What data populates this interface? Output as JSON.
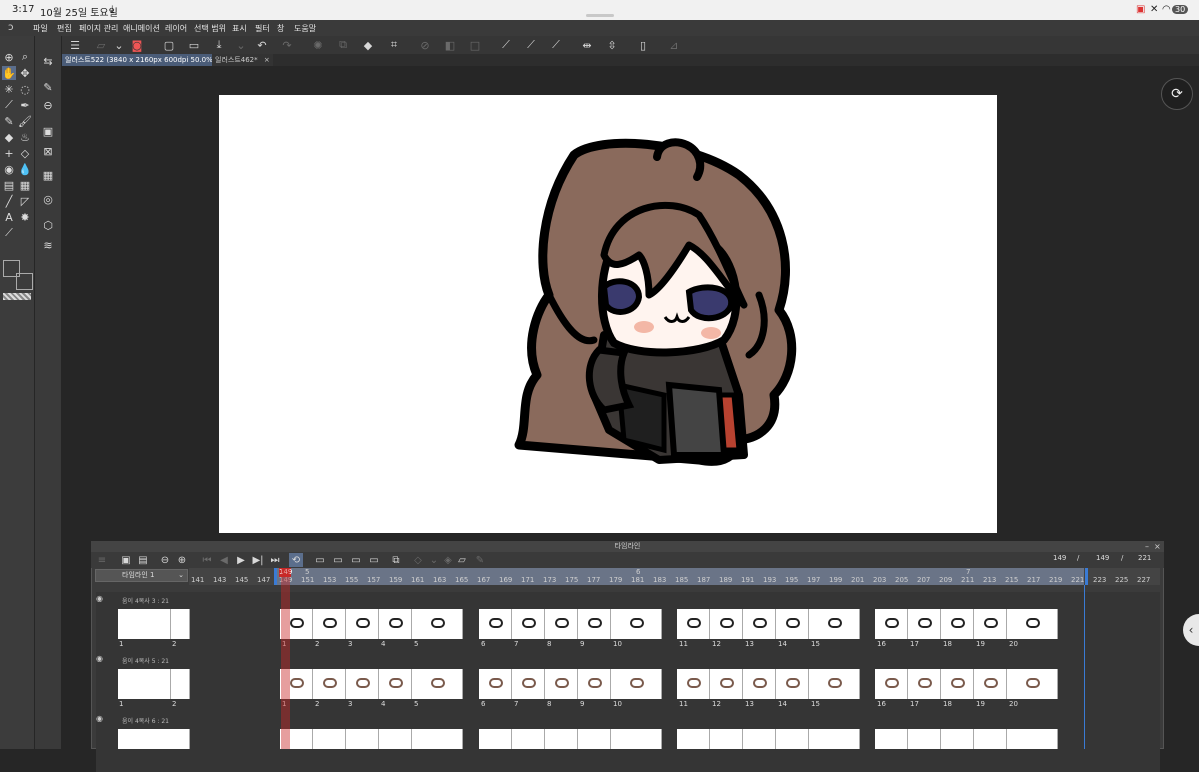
{
  "status": {
    "time": "3:17",
    "date": "10월 25일 토요일",
    "battery": "30"
  },
  "menu": [
    "파일",
    "편집",
    "페이지 관리",
    "애니메이션",
    "레이어",
    "선택 범위",
    "표시",
    "필터",
    "창",
    "도움말"
  ],
  "tabs": [
    {
      "label": "일러스트522 (3840 x 2160px 600dpi 50.0%)"
    },
    {
      "label": "일러스트462*"
    }
  ],
  "timeline": {
    "title": "타임라인",
    "name": "타임라인 1",
    "counter": [
      "149",
      "/",
      "149",
      "/",
      "221"
    ],
    "frame_labels": [
      "141",
      "143",
      "145",
      "147",
      "149",
      "151",
      "153",
      "155",
      "157",
      "159",
      "161",
      "163",
      "165",
      "167",
      "169",
      "171",
      "173",
      "175",
      "177",
      "179",
      "181",
      "183",
      "185",
      "187",
      "189",
      "191",
      "193",
      "195",
      "197",
      "199",
      "201",
      "203",
      "205",
      "207",
      "209",
      "211",
      "213",
      "215",
      "217",
      "219",
      "221",
      "223",
      "225",
      "227"
    ],
    "current_frame": "149",
    "second_markers": [
      "5",
      "6",
      "7"
    ],
    "layers": [
      {
        "name": "움이 4복사 3 : 21",
        "lead_cels": [
          "1",
          "2"
        ],
        "cels": [
          "1",
          "2",
          "3",
          "4",
          "5",
          "6",
          "7",
          "8",
          "9",
          "10",
          "11",
          "12",
          "13",
          "14",
          "15",
          "16",
          "17",
          "18",
          "19",
          "20"
        ]
      },
      {
        "name": "움이 4복사 5 : 21",
        "lead_cels": [
          "1",
          "2"
        ],
        "cels": [
          "1",
          "2",
          "3",
          "4",
          "5",
          "6",
          "7",
          "8",
          "9",
          "10",
          "11",
          "12",
          "13",
          "14",
          "15",
          "16",
          "17",
          "18",
          "19",
          "20"
        ]
      },
      {
        "name": "움이 4복사 6 : 21",
        "lead_cels": [],
        "cels": []
      }
    ]
  },
  "colors": {
    "main": "#fdd0c1",
    "sub": "#ffffff",
    "selection": "#5b6e8c",
    "playhead": "#c82828",
    "accent_blue": "#3a7bd5"
  },
  "icons": {
    "rotate": "rotate-view-icon",
    "side": "side-handle-icon"
  }
}
